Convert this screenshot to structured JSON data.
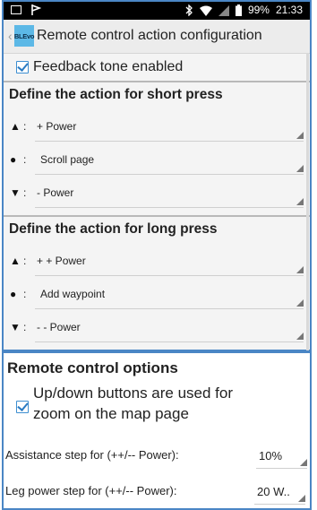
{
  "status_bar": {
    "battery": "99%",
    "time": "21:33",
    "icons": [
      "notification-icon",
      "flag-icon",
      "bluetooth-icon",
      "wifi-icon",
      "signal-icon",
      "battery-icon"
    ]
  },
  "app_bar": {
    "logo_text": "BLEvo",
    "title": "Remote control action configuration"
  },
  "feedback": {
    "label": "Feedback tone enabled",
    "checked": true
  },
  "short_press": {
    "header": "Define the action for short press",
    "rows": [
      {
        "symbol": "▲",
        "value": "+ Power"
      },
      {
        "symbol": "●",
        "value": "Scroll page"
      },
      {
        "symbol": "▼",
        "value": "- Power"
      }
    ]
  },
  "long_press": {
    "header": "Define the action for long press",
    "rows": [
      {
        "symbol": "▲",
        "value": "+ + Power"
      },
      {
        "symbol": "●",
        "value": "Add waypoint"
      },
      {
        "symbol": "▼",
        "value": "- - Power"
      }
    ]
  },
  "remote_options": {
    "header": "Remote control options",
    "zoom_option": {
      "line1": "Up/down buttons are used for",
      "line2": "zoom on the map page",
      "checked": true
    },
    "assistance_step": {
      "label": "Assistance step for (++/-- Power):",
      "value": "10%"
    },
    "leg_power_step": {
      "label": "Leg power step for (++/-- Power):",
      "value": "20 W.."
    }
  },
  "colors": {
    "accent": "#3d8fd1",
    "panel_border": "#4a86c5",
    "logo_bg": "#5cb8e6"
  }
}
